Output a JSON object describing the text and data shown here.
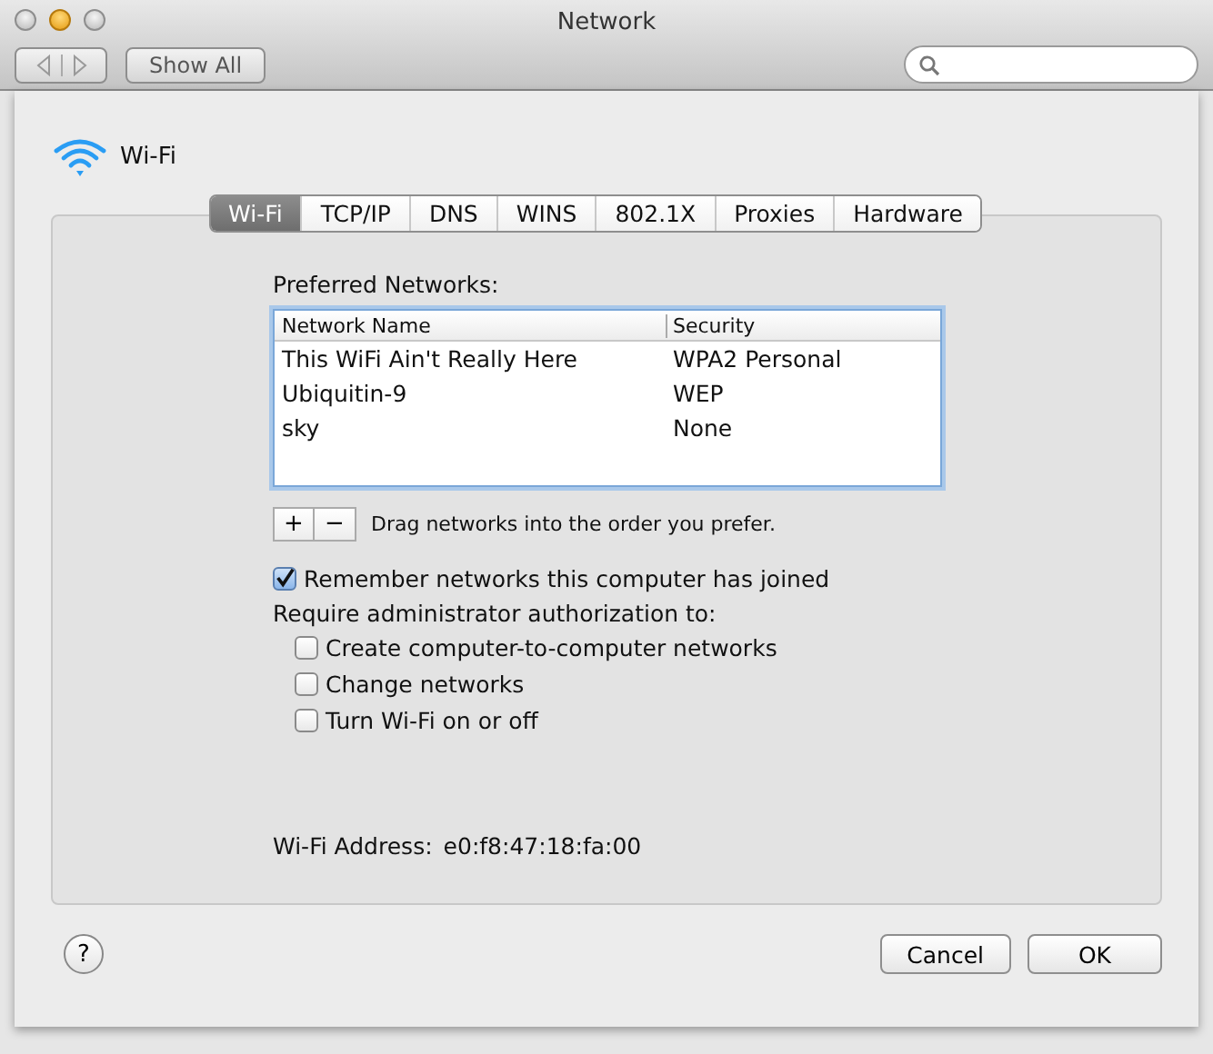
{
  "window": {
    "title": "Network"
  },
  "toolbar": {
    "show_all": "Show All"
  },
  "service": {
    "name": "Wi-Fi"
  },
  "tabs": [
    {
      "label": "Wi-Fi",
      "selected": true
    },
    {
      "label": "TCP/IP",
      "selected": false
    },
    {
      "label": "DNS",
      "selected": false
    },
    {
      "label": "WINS",
      "selected": false
    },
    {
      "label": "802.1X",
      "selected": false
    },
    {
      "label": "Proxies",
      "selected": false
    },
    {
      "label": "Hardware",
      "selected": false
    }
  ],
  "preferred_networks": {
    "label": "Preferred Networks:",
    "columns": [
      "Network Name",
      "Security"
    ],
    "rows": [
      {
        "name": "This WiFi Ain't Really Here",
        "security": "WPA2 Personal",
        "selected": false
      },
      {
        "name": "Ubiquitin-9",
        "security": "WEP",
        "selected": false
      },
      {
        "name": "sky",
        "security": "None",
        "selected": false
      }
    ],
    "add": "+",
    "remove": "−",
    "hint": "Drag networks into the order you prefer."
  },
  "remember": {
    "label": "Remember networks this computer has joined",
    "checked": true
  },
  "require_label": "Require administrator authorization to:",
  "require_options": [
    {
      "label": "Create computer-to-computer networks",
      "checked": false
    },
    {
      "label": "Change networks",
      "checked": false
    },
    {
      "label": "Turn Wi-Fi on or off",
      "checked": false
    }
  ],
  "address": {
    "label": "Wi-Fi Address:",
    "value": "e0:f8:47:18:fa:00"
  },
  "help": "?",
  "buttons": [
    "Cancel",
    "OK"
  ]
}
